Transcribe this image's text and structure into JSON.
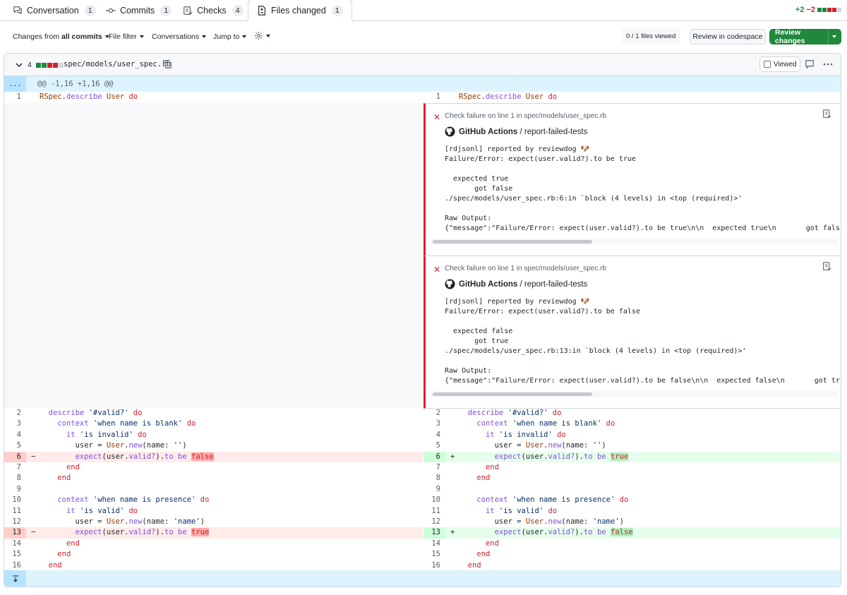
{
  "tabs": [
    {
      "label": "Conversation",
      "count": "1",
      "icon": "comment-discussion-icon"
    },
    {
      "label": "Commits",
      "count": "1",
      "icon": "git-commit-icon"
    },
    {
      "label": "Checks",
      "count": "4",
      "icon": "checklist-icon"
    },
    {
      "label": "Files changed",
      "count": "1",
      "icon": "file-diff-icon"
    }
  ],
  "diffstat": {
    "added": "+2",
    "removed": "−2",
    "color_add": "#1f883d",
    "color_del": "#cf222e"
  },
  "toolbar": {
    "changes_from_prefix": "Changes from",
    "changes_from_value": "all commits",
    "file_filter": "File filter",
    "conversations": "Conversations",
    "jump_to": "Jump to",
    "files_viewed": "0 / 1 files viewed",
    "review_codespace": "Review in codespace",
    "review_changes": "Review changes"
  },
  "file": {
    "change_count": "4",
    "name": "spec/models/user_spec.rb",
    "viewed_label": "Viewed"
  },
  "hunk": {
    "expand_label": "...",
    "header": "@@ -1,16 +1,16 @@"
  },
  "annotations": [
    {
      "title": "Check failure on line 1 in spec/models/user_spec.rb",
      "source_app": "GitHub Actions",
      "source_sep": " / ",
      "source_job": "report-failed-tests",
      "lines": [
        "[rdjsonl] reported by reviewdog 🐶",
        "Failure/Error: expect(user.valid?).to be true",
        "",
        "  expected true",
        "       got false",
        "./spec/models/user_spec.rb:6:in `block (4 levels) in <top (required)>'",
        "",
        "Raw Output:",
        "{\"message\":\"Failure/Error: expect(user.valid?).to be true\\n\\n  expected true\\n       got false\\n./spe"
      ]
    },
    {
      "title": "Check failure on line 1 in spec/models/user_spec.rb",
      "source_app": "GitHub Actions",
      "source_sep": " / ",
      "source_job": "report-failed-tests",
      "lines": [
        "[rdjsonl] reported by reviewdog 🐶",
        "Failure/Error: expect(user.valid?).to be false",
        "",
        "  expected false",
        "       got true",
        "./spec/models/user_spec.rb:13:in `block (4 levels) in <top (required)>'",
        "",
        "Raw Output:",
        "{\"message\":\"Failure/Error: expect(user.valid?).to be false\\n\\n  expected false\\n       got true\\n./sp"
      ]
    }
  ],
  "left_lines": [
    {
      "n": "1",
      "type": "ctx",
      "code": [
        [
          "cls",
          "RSpec"
        ],
        [
          "",
          "."
        ],
        [
          "fn",
          "describe"
        ],
        [
          "",
          " "
        ],
        [
          "cls",
          "User"
        ],
        [
          "",
          " "
        ],
        [
          "kw",
          "do"
        ]
      ]
    },
    {
      "n": "2",
      "type": "ctx",
      "code": [
        [
          "",
          "  "
        ],
        [
          "fn",
          "describe"
        ],
        [
          "",
          " "
        ],
        [
          "str",
          "'#valid?'"
        ],
        [
          "",
          " "
        ],
        [
          "kw",
          "do"
        ]
      ]
    },
    {
      "n": "3",
      "type": "ctx",
      "code": [
        [
          "",
          "    "
        ],
        [
          "fn",
          "context"
        ],
        [
          "",
          " "
        ],
        [
          "str",
          "'when name is blank'"
        ],
        [
          "",
          " "
        ],
        [
          "kw",
          "do"
        ]
      ]
    },
    {
      "n": "4",
      "type": "ctx",
      "code": [
        [
          "",
          "      "
        ],
        [
          "fn",
          "it"
        ],
        [
          "",
          " "
        ],
        [
          "str",
          "'is invalid'"
        ],
        [
          "",
          " "
        ],
        [
          "kw",
          "do"
        ]
      ]
    },
    {
      "n": "5",
      "type": "ctx",
      "code": [
        [
          "",
          "        user = "
        ],
        [
          "cls",
          "User"
        ],
        [
          "",
          "."
        ],
        [
          "fn",
          "new"
        ],
        [
          "",
          "(name: "
        ],
        [
          "str",
          "''"
        ],
        [
          "",
          ")"
        ]
      ]
    },
    {
      "n": "6",
      "type": "del",
      "mark": "−",
      "code": [
        [
          "",
          "        "
        ],
        [
          "fn",
          "expect"
        ],
        [
          "",
          "(user."
        ],
        [
          "fn",
          "valid?"
        ],
        [
          "",
          ")."
        ],
        [
          "fn",
          "to"
        ],
        [
          "",
          " "
        ],
        [
          "fn",
          "be"
        ],
        [
          "",
          " "
        ],
        [
          "hl-del kw",
          "false"
        ]
      ]
    },
    {
      "n": "7",
      "type": "ctx",
      "code": [
        [
          "",
          "      "
        ],
        [
          "kw",
          "end"
        ]
      ]
    },
    {
      "n": "8",
      "type": "ctx",
      "code": [
        [
          "",
          "    "
        ],
        [
          "kw",
          "end"
        ]
      ]
    },
    {
      "n": "9",
      "type": "ctx",
      "code": []
    },
    {
      "n": "10",
      "type": "ctx",
      "code": [
        [
          "",
          "    "
        ],
        [
          "fn",
          "context"
        ],
        [
          "",
          " "
        ],
        [
          "str",
          "'when name is presence'"
        ],
        [
          "",
          " "
        ],
        [
          "kw",
          "do"
        ]
      ]
    },
    {
      "n": "11",
      "type": "ctx",
      "code": [
        [
          "",
          "      "
        ],
        [
          "fn",
          "it"
        ],
        [
          "",
          " "
        ],
        [
          "str",
          "'is valid'"
        ],
        [
          "",
          " "
        ],
        [
          "kw",
          "do"
        ]
      ]
    },
    {
      "n": "12",
      "type": "ctx",
      "code": [
        [
          "",
          "        user = "
        ],
        [
          "cls",
          "User"
        ],
        [
          "",
          "."
        ],
        [
          "fn",
          "new"
        ],
        [
          "",
          "(name: "
        ],
        [
          "str",
          "'name'"
        ],
        [
          "",
          ")"
        ]
      ]
    },
    {
      "n": "13",
      "type": "del",
      "mark": "−",
      "code": [
        [
          "",
          "        "
        ],
        [
          "fn",
          "expect"
        ],
        [
          "",
          "(user."
        ],
        [
          "fn",
          "valid?"
        ],
        [
          "",
          ")."
        ],
        [
          "fn",
          "to"
        ],
        [
          "",
          " "
        ],
        [
          "fn",
          "be"
        ],
        [
          "",
          " "
        ],
        [
          "hl-del kw",
          "true"
        ]
      ]
    },
    {
      "n": "14",
      "type": "ctx",
      "code": [
        [
          "",
          "      "
        ],
        [
          "kw",
          "end"
        ]
      ]
    },
    {
      "n": "15",
      "type": "ctx",
      "code": [
        [
          "",
          "    "
        ],
        [
          "kw",
          "end"
        ]
      ]
    },
    {
      "n": "16",
      "type": "ctx",
      "code": [
        [
          "",
          "  "
        ],
        [
          "kw",
          "end"
        ]
      ]
    }
  ],
  "right_lines": [
    {
      "n": "1",
      "type": "ctx",
      "code": [
        [
          "cls",
          "RSpec"
        ],
        [
          "",
          "."
        ],
        [
          "fn",
          "describe"
        ],
        [
          "",
          " "
        ],
        [
          "cls",
          "User"
        ],
        [
          "",
          " "
        ],
        [
          "kw",
          "do"
        ]
      ]
    },
    {
      "n": "2",
      "type": "ctx",
      "code": [
        [
          "",
          "  "
        ],
        [
          "fn",
          "describe"
        ],
        [
          "",
          " "
        ],
        [
          "str",
          "'#valid?'"
        ],
        [
          "",
          " "
        ],
        [
          "kw",
          "do"
        ]
      ]
    },
    {
      "n": "3",
      "type": "ctx",
      "code": [
        [
          "",
          "    "
        ],
        [
          "fn",
          "context"
        ],
        [
          "",
          " "
        ],
        [
          "str",
          "'when name is blank'"
        ],
        [
          "",
          " "
        ],
        [
          "kw",
          "do"
        ]
      ]
    },
    {
      "n": "4",
      "type": "ctx",
      "code": [
        [
          "",
          "      "
        ],
        [
          "fn",
          "it"
        ],
        [
          "",
          " "
        ],
        [
          "str",
          "'is invalid'"
        ],
        [
          "",
          " "
        ],
        [
          "kw",
          "do"
        ]
      ]
    },
    {
      "n": "5",
      "type": "ctx",
      "code": [
        [
          "",
          "        user = "
        ],
        [
          "cls",
          "User"
        ],
        [
          "",
          "."
        ],
        [
          "fn",
          "new"
        ],
        [
          "",
          "(name: "
        ],
        [
          "str",
          "''"
        ],
        [
          "",
          ")"
        ]
      ]
    },
    {
      "n": "6",
      "type": "add",
      "mark": "+",
      "code": [
        [
          "",
          "        "
        ],
        [
          "fn",
          "expect"
        ],
        [
          "",
          "(user."
        ],
        [
          "fn",
          "valid?"
        ],
        [
          "",
          ")."
        ],
        [
          "fn",
          "to"
        ],
        [
          "",
          " "
        ],
        [
          "fn",
          "be"
        ],
        [
          "",
          " "
        ],
        [
          "hl-add kw",
          "true"
        ]
      ]
    },
    {
      "n": "7",
      "type": "ctx",
      "code": [
        [
          "",
          "      "
        ],
        [
          "kw",
          "end"
        ]
      ]
    },
    {
      "n": "8",
      "type": "ctx",
      "code": [
        [
          "",
          "    "
        ],
        [
          "kw",
          "end"
        ]
      ]
    },
    {
      "n": "9",
      "type": "ctx",
      "code": []
    },
    {
      "n": "10",
      "type": "ctx",
      "code": [
        [
          "",
          "    "
        ],
        [
          "fn",
          "context"
        ],
        [
          "",
          " "
        ],
        [
          "str",
          "'when name is presence'"
        ],
        [
          "",
          " "
        ],
        [
          "kw",
          "do"
        ]
      ]
    },
    {
      "n": "11",
      "type": "ctx",
      "code": [
        [
          "",
          "      "
        ],
        [
          "fn",
          "it"
        ],
        [
          "",
          " "
        ],
        [
          "str",
          "'is valid'"
        ],
        [
          "",
          " "
        ],
        [
          "kw",
          "do"
        ]
      ]
    },
    {
      "n": "12",
      "type": "ctx",
      "code": [
        [
          "",
          "        user = "
        ],
        [
          "cls",
          "User"
        ],
        [
          "",
          "."
        ],
        [
          "fn",
          "new"
        ],
        [
          "",
          "(name: "
        ],
        [
          "str",
          "'name'"
        ],
        [
          "",
          ")"
        ]
      ]
    },
    {
      "n": "13",
      "type": "add",
      "mark": "+",
      "code": [
        [
          "",
          "        "
        ],
        [
          "fn",
          "expect"
        ],
        [
          "",
          "(user."
        ],
        [
          "fn",
          "valid?"
        ],
        [
          "",
          ")."
        ],
        [
          "fn",
          "to"
        ],
        [
          "",
          " "
        ],
        [
          "fn",
          "be"
        ],
        [
          "",
          " "
        ],
        [
          "hl-add kw",
          "false"
        ]
      ]
    },
    {
      "n": "14",
      "type": "ctx",
      "code": [
        [
          "",
          "      "
        ],
        [
          "kw",
          "end"
        ]
      ]
    },
    {
      "n": "15",
      "type": "ctx",
      "code": [
        [
          "",
          "    "
        ],
        [
          "kw",
          "end"
        ]
      ]
    },
    {
      "n": "16",
      "type": "ctx",
      "code": [
        [
          "",
          "  "
        ],
        [
          "kw",
          "end"
        ]
      ]
    }
  ]
}
